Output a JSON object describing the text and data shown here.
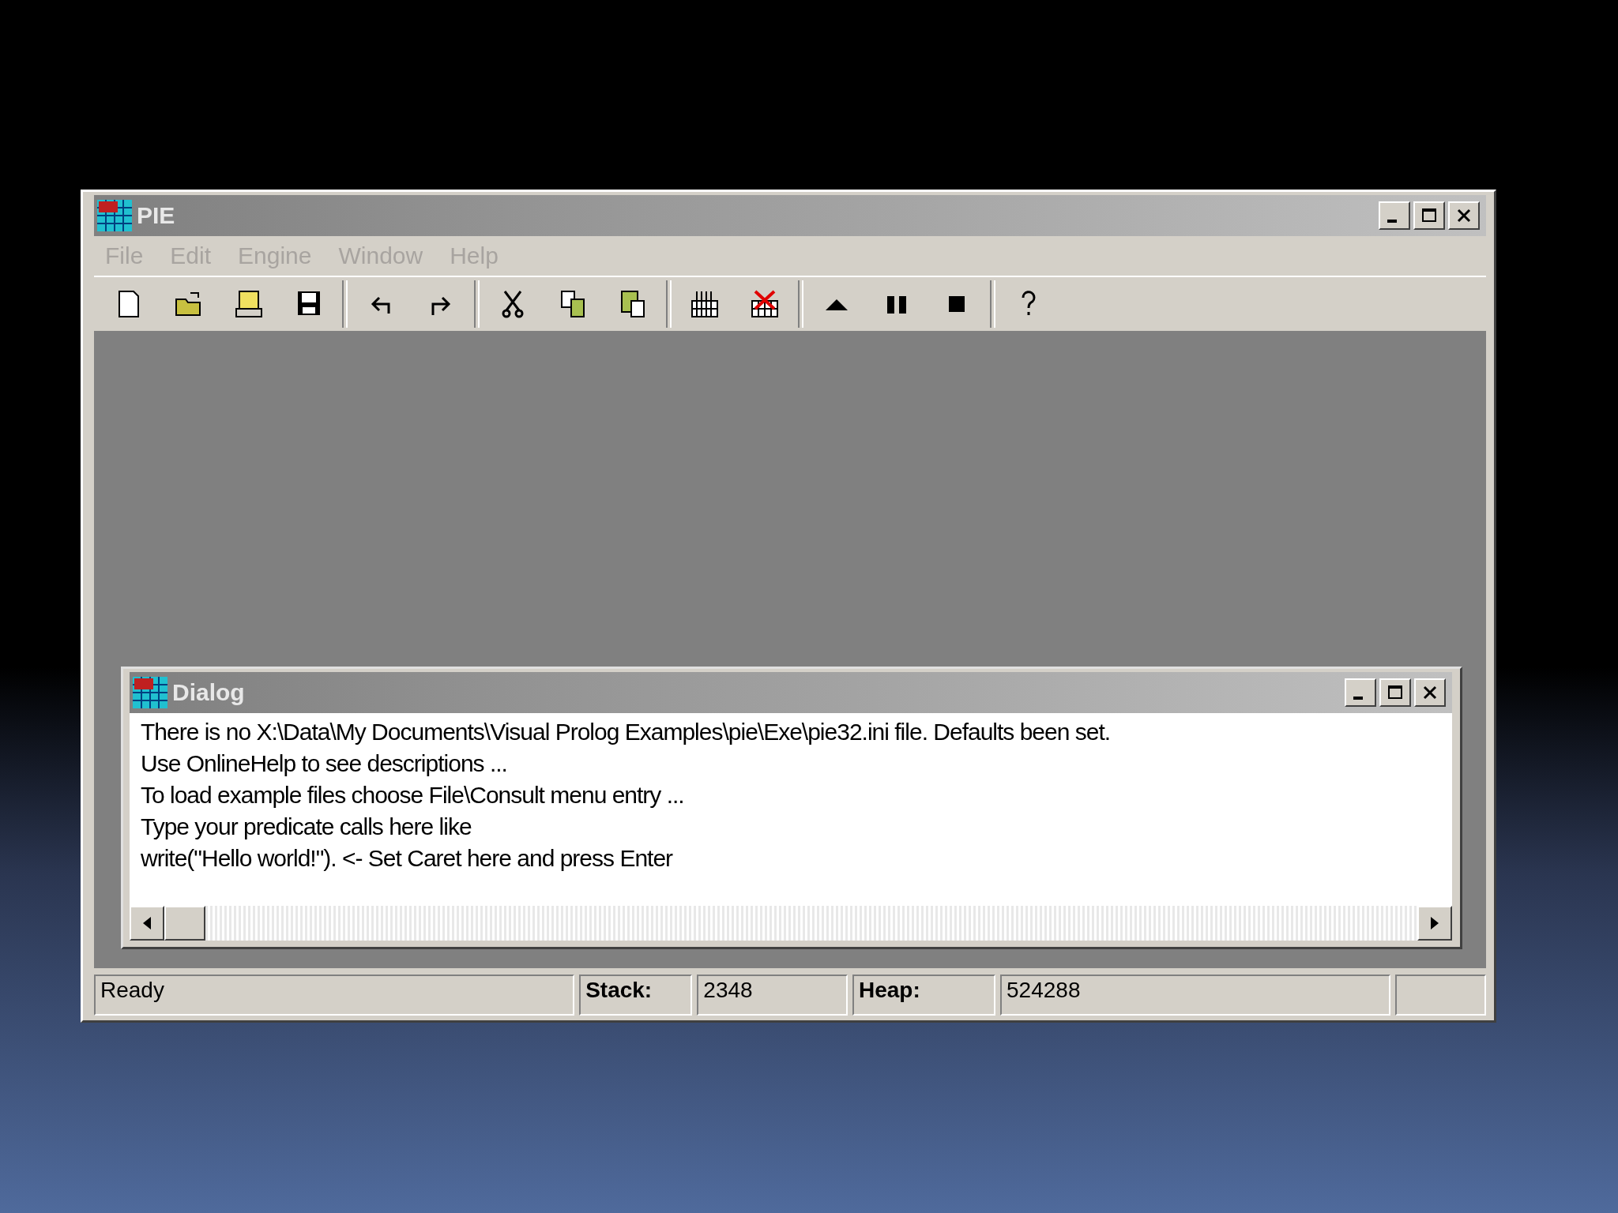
{
  "window": {
    "title": "PIE"
  },
  "menu": [
    "File",
    "Edit",
    "Engine",
    "Window",
    "Help"
  ],
  "dialog": {
    "title": "Dialog",
    "lines": [
      "There is no X:\\Data\\My Documents\\Visual Prolog Examples\\pie\\Exe\\pie32.ini file. Defaults been set.",
      "Use OnlineHelp to see descriptions ...",
      "To load example files choose File\\Consult menu entry ...",
      "Type your predicate calls here like",
      "write(\"Hello world!\"). <- Set Caret here and press Enter"
    ]
  },
  "status_bar": [
    {
      "kind": "text",
      "text": "Ready"
    },
    {
      "kind": "label",
      "text": "Stack:"
    },
    {
      "kind": "text",
      "text": "2348"
    },
    {
      "kind": "label",
      "text": "Heap:"
    },
    {
      "kind": "text",
      "text": "524288"
    }
  ]
}
